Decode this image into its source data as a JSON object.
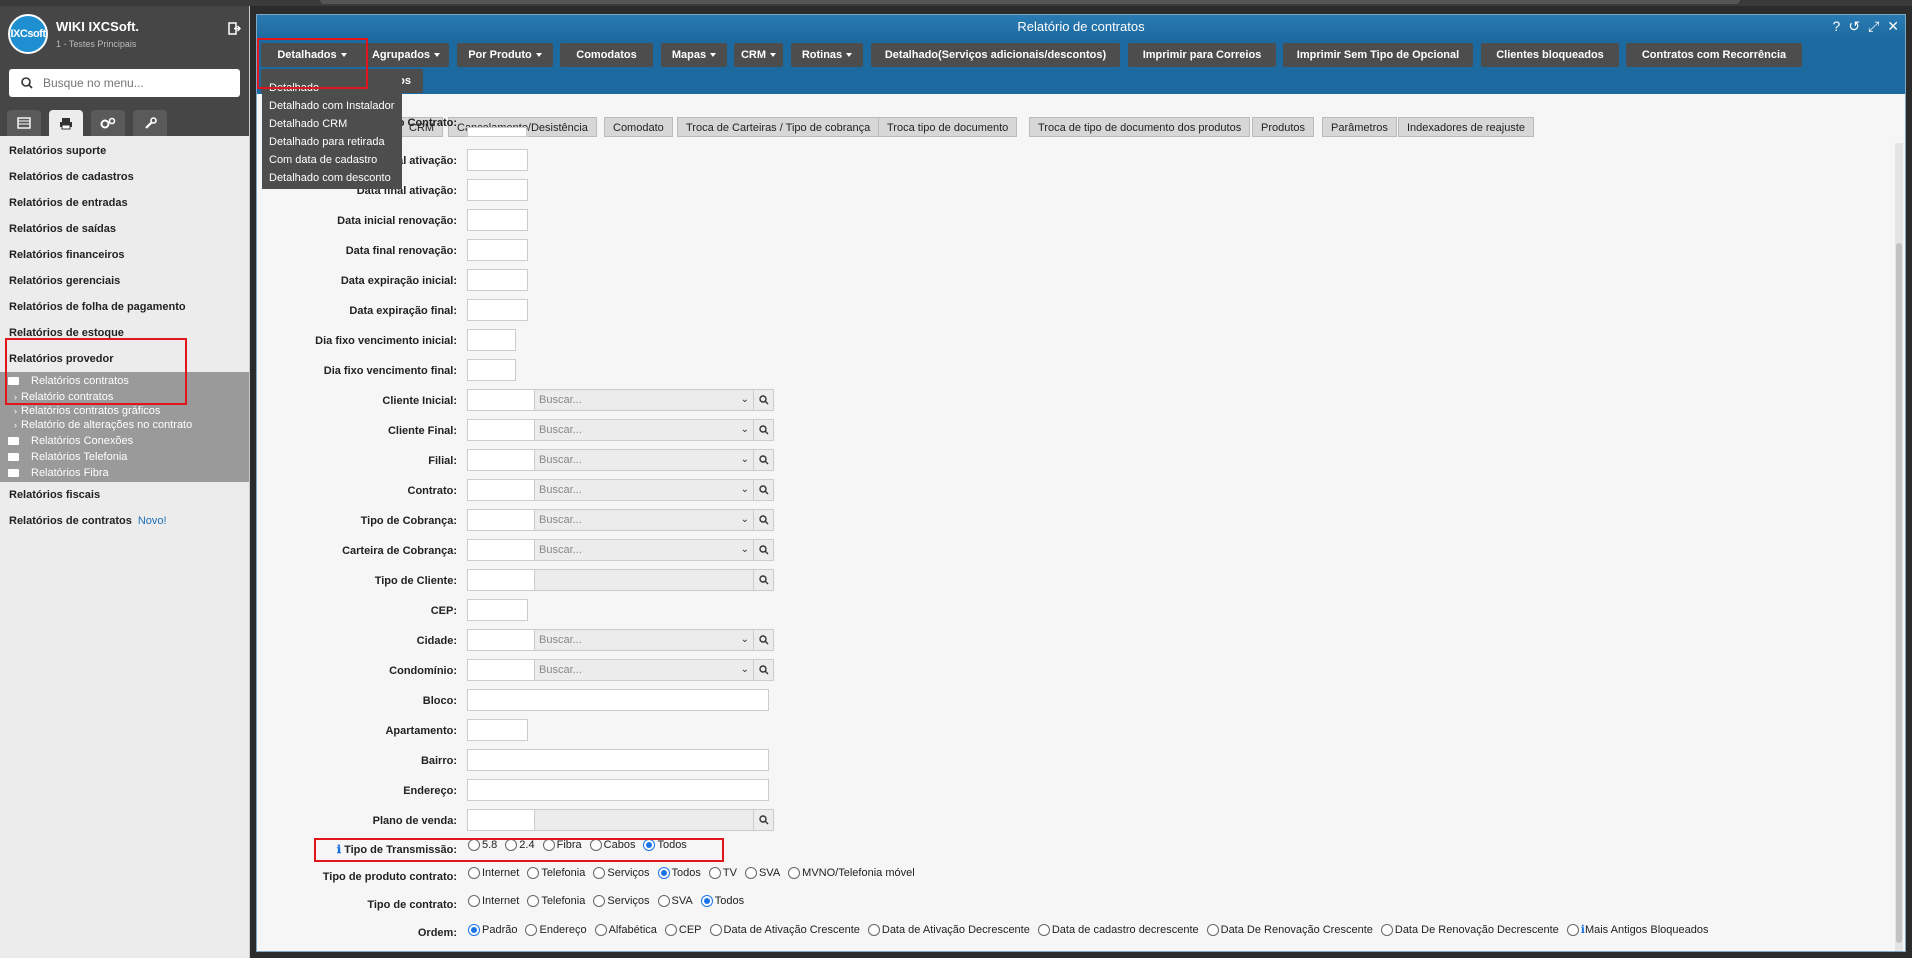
{
  "sidebar": {
    "brand_title": "WIKI IXCSoft.",
    "brand_sub": "1 - Testes Principais",
    "logo_text": "IXCsoft",
    "search_placeholder": "Busque no menu...",
    "menu": [
      "Relatórios suporte",
      "Relatórios de cadastros",
      "Relatórios de entradas",
      "Relatórios de saídas",
      "Relatórios financeiros",
      "Relatórios gerenciais",
      "Relatórios de folha de pagamento",
      "Relatórios de estoque",
      "Relatórios provedor"
    ],
    "sub": {
      "contratos_folder": "Relatórios contratos",
      "relatorio_contratos": "Relatório contratos",
      "contratos_graficos": "Relatórios contratos gráficos",
      "alteracoes": "Relatório de alterações no contrato",
      "conexoes": "Relatórios Conexões",
      "telefonia": "Relatórios Telefonia",
      "fibra": "Relatórios Fibra"
    },
    "fiscais": "Relatórios fiscais",
    "contratos_novo": "Relatórios de contratos",
    "novo_badge": "Novo!"
  },
  "window": {
    "title": "Relatório de contratos"
  },
  "toolbar": {
    "detalhados": "Detalhados",
    "agrupados": "Agrupados",
    "por_produto": "Por Produto",
    "comodatos": "Comodatos",
    "mapas": "Mapas",
    "crm": "CRM",
    "rotinas": "Rotinas",
    "detalhado_servicos": "Detalhado(Serviços adicionais/descontos)",
    "imprimir_correios": "Imprimir para Correios",
    "imprimir_sem_tipo": "Imprimir Sem Tipo de Opcional",
    "clientes_bloqueados": "Clientes bloqueados",
    "contratos_recorrencia": "Contratos com Recorrência",
    "hidden_second": "os"
  },
  "dropdown": [
    "Detalhado",
    "Detalhado com Instalador",
    "Detalhado CRM",
    "Detalhado para retirada",
    "Com data de cadastro",
    "Detalhado com desconto"
  ],
  "tabs": [
    "CRM",
    "Cancelamento/Desistência",
    "Comodato",
    "Troca de Carteiras / Tipo de cobrança",
    "Troca tipo de documento",
    "Troca de tipo de documento dos produtos",
    "Produtos",
    "Parâmetros",
    "Indexadores de reajuste"
  ],
  "form": {
    "contrato_partial": "o Contrato:",
    "ativ_ini_partial": "al ativação:",
    "ativ_fin_partial": "Data final ativação:",
    "renov_ini": "Data inicial renovação:",
    "renov_fin": "Data final renovação:",
    "exp_ini": "Data expiração inicial:",
    "exp_fin": "Data expiração final:",
    "dia_ini": "Dia fixo vencimento inicial:",
    "dia_fin": "Dia fixo vencimento final:",
    "cliente_ini": "Cliente Inicial:",
    "cliente_fin": "Cliente Final:",
    "filial": "Filial:",
    "contrato": "Contrato:",
    "tipo_cobranca": "Tipo de Cobrança:",
    "carteira": "Carteira de Cobrança:",
    "tipo_cliente": "Tipo de Cliente:",
    "cep": "CEP:",
    "cidade": "Cidade:",
    "condominio": "Condomínio:",
    "bloco": "Bloco:",
    "apartamento": "Apartamento:",
    "bairro": "Bairro:",
    "endereco": "Endereço:",
    "plano": "Plano de venda:",
    "transmissao": "Tipo de Transmissão:",
    "tipo_produto": "Tipo de produto contrato:",
    "tipo_contrato": "Tipo de contrato:",
    "ordem": "Ordem:",
    "buscar": "Buscar..."
  },
  "radios": {
    "transmissao": [
      "5.8",
      "2.4",
      "Fibra",
      "Cabos",
      "Todos"
    ],
    "transmissao_selected": "Todos",
    "tipo_produto": [
      "Internet",
      "Telefonia",
      "Serviços",
      "Todos",
      "TV",
      "SVA",
      "MVNO/Telefonia móvel"
    ],
    "tipo_produto_selected": "Todos",
    "tipo_contrato": [
      "Internet",
      "Telefonia",
      "Serviços",
      "SVA",
      "Todos"
    ],
    "tipo_contrato_selected": "Todos",
    "ordem": [
      "Padrão",
      "Endereço",
      "Alfabética",
      "CEP",
      "Data de Ativação Crescente",
      "Data de Ativação Decrescente",
      "Data de cadastro decrescente",
      "Data De Renovação Crescente",
      "Data De Renovação Decrescente",
      "Mais Antigos Bloqueados"
    ],
    "ordem_selected": "Padrão"
  },
  "colors": {
    "accent": "#1c6aa0",
    "highlight": "#e0161c",
    "selected_radio": "#1a73e8"
  }
}
